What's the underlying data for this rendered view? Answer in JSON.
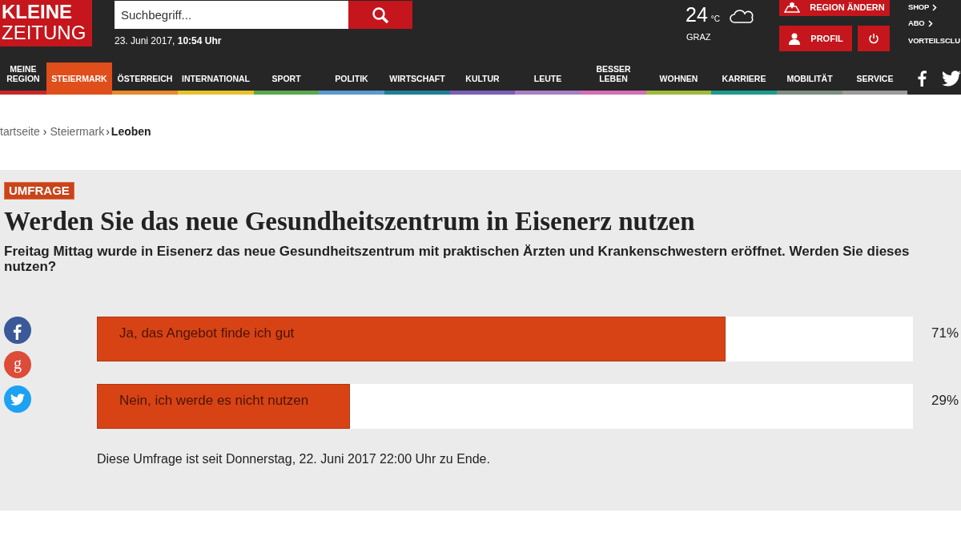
{
  "header": {
    "logo": [
      "KLEINE",
      "ZEITUNG"
    ],
    "search": {
      "placeholder": "Suchbegriff..."
    },
    "date": "23. Juni 2017,",
    "time": "10:54 Uhr",
    "weather": {
      "temperature": "24",
      "unit": "°C",
      "city": "GRAZ"
    },
    "buttons": [
      "REGION ÄNDERN",
      "PROFIL"
    ],
    "links": [
      "SHOP",
      "ABO",
      "VORTEILSCLU"
    ]
  },
  "nav": [
    {
      "label": "MEINE REGION",
      "color": "#c62828",
      "selected": false
    },
    {
      "label": "STEIERMARK",
      "color": "#e04e1b",
      "selected": true
    },
    {
      "label": "ÖSTERREICH",
      "color": "#e8892b",
      "selected": false
    },
    {
      "label": "INTERNATIONAL",
      "color": "#e8c12b",
      "selected": false
    },
    {
      "label": "SPORT",
      "color": "#5aa84e",
      "selected": false
    },
    {
      "label": "POLITIK",
      "color": "#5b9ad0",
      "selected": false
    },
    {
      "label": "WIRTSCHAFT",
      "color": "#1f7f96",
      "selected": false
    },
    {
      "label": "KULTUR",
      "color": "#7a5fb5",
      "selected": false
    },
    {
      "label": "LEUTE",
      "color": "#a77fc4",
      "selected": false
    },
    {
      "label": "BESSER LEBEN",
      "color": "#d46fb4",
      "selected": false
    },
    {
      "label": "WOHNEN",
      "color": "#9cbb3a",
      "selected": false
    },
    {
      "label": "KARRIERE",
      "color": "#1e9a8c",
      "selected": false
    },
    {
      "label": "MOBILITÄT",
      "color": "#7d8f83",
      "selected": false
    },
    {
      "label": "SERVICE",
      "color": "#9a9a9a",
      "selected": false
    }
  ],
  "breadcrumb": [
    "tartseite",
    "›",
    "Steiermark",
    "›",
    "Leoben"
  ],
  "poll": {
    "tag": "UMFRAGE",
    "title": "Werden Sie das neue Gesundheitszentrum in Eisenerz nutzen",
    "lead": "Freitag Mittag wurde in Eisenerz das neue Gesundheitszentrum mit praktischen Ärzten und Krankenschwestern eröffnet. Werden Sie dieses nutzen?",
    "answers": [
      {
        "label": "Ja, das Angebot finde ich gut",
        "level": 0.77,
        "percent": "71%"
      },
      {
        "label": "Nein, ich werde es nicht nutzen",
        "level": 0.31,
        "percent": "29%"
      }
    ],
    "note": "Diese Umfrage ist seit Donnerstag, 22. Juni 2017 22:00 Uhr zu Ende."
  },
  "share": [
    {
      "kind": "facebook",
      "color": "#3b5998"
    },
    {
      "kind": "google",
      "color": "#dd4b39",
      "glyph": "g"
    },
    {
      "kind": "twitter",
      "color": "#1da1f2"
    }
  ]
}
